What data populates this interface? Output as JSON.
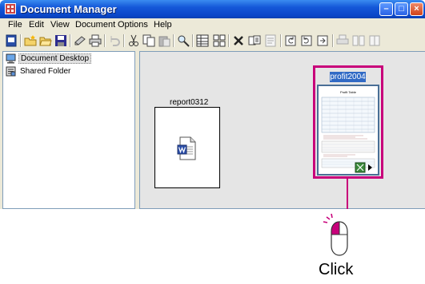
{
  "window": {
    "title": "Document Manager",
    "controls": [
      "minimize",
      "maximize",
      "close"
    ]
  },
  "menu": [
    "File",
    "Edit",
    "View",
    "Document",
    "Options",
    "Help"
  ],
  "toolbar_icons": [
    "new-desktop-icon",
    "new-folder-icon",
    "open-folder-icon",
    "save-icon",
    "scan-icon",
    "print-icon",
    "undo-icon",
    "cut-icon",
    "copy-icon",
    "paste-icon",
    "find-icon",
    "details-view-icon",
    "thumbnail-view-icon",
    "delete-icon",
    "duplicate-icon",
    "properties-icon",
    "rotate-left-icon",
    "rotate-right-icon",
    "rotate-180-icon",
    "print-preview-icon",
    "split-icon",
    "merge-icon"
  ],
  "tree": [
    {
      "label": "Document Desktop",
      "icon": "desktop-icon",
      "selected": true
    },
    {
      "label": "Shared Folder",
      "icon": "shared-folder-icon",
      "selected": false
    }
  ],
  "documents": [
    {
      "name": "report0312",
      "type": "word-document",
      "selected": false
    },
    {
      "name": "profit2004",
      "type": "spreadsheet-preview",
      "selected": true,
      "preview_title": "Profit Table"
    }
  ],
  "callout": {
    "label": "Click",
    "highlight_color": "#c8007a"
  },
  "colors": {
    "titlebar": "#0a46c8",
    "chrome": "#ece9d8",
    "selection": "#316ac5"
  }
}
